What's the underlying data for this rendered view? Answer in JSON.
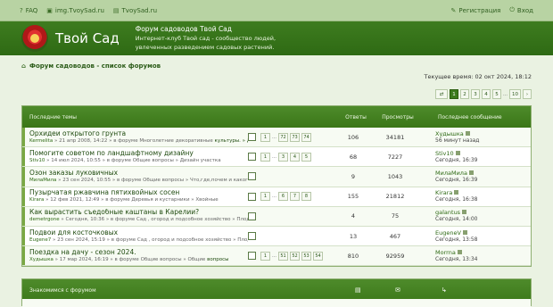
{
  "topbar": {
    "faq": "FAQ",
    "link1": "img.TvoySad.ru",
    "link2": "TvoySad.ru",
    "register": "Регистрация",
    "login": "Вход"
  },
  "header": {
    "site_name": "Твой Сад",
    "title": "Форум садоводов Твой Сад",
    "desc1": "Интернет-клуб Твой сад - сообщество людей,",
    "desc2": "увлеченных разведением садовых растений."
  },
  "breadcrumb": "Форум садоводов - список форумов",
  "time": "Текущее время: 02 окт 2024, 18:12",
  "pagination": {
    "pages": [
      "1",
      "2",
      "3",
      "4",
      "5",
      "…",
      "10"
    ],
    "active": "1"
  },
  "topics_panel": {
    "header": {
      "topics": "Последние темы",
      "replies": "Ответы",
      "views": "Просмотры",
      "last_post": "Последнее сообщение"
    },
    "rows": [
      {
        "title": "Орхидеи открытого грунта",
        "author": "Kermelita",
        "meta": " » 21 апр 2008, 14:22 » в форуме Многолетние декоративные",
        "forum2": "культуры. » Другие виды",
        "pages": [
          "72",
          "73",
          "74"
        ],
        "replies": "106",
        "views": "34181",
        "last_author": "Худышка",
        "last_date": "56 минут назад"
      },
      {
        "title": "Помогите советом по ландшафтному дизайну",
        "author": "Stiv10",
        "meta": " » 14 июл 2024, 10:55 » в форуме Общие вопросы » Дизайн участка",
        "forum2": "",
        "pages": [
          "3",
          "4",
          "5"
        ],
        "replies": "68",
        "views": "7227",
        "last_author": "Stiv10",
        "last_date": "Сегодня, 16:39"
      },
      {
        "title": "Озон заказы луковичных",
        "author": "МилаМила",
        "meta": " » 23 сен 2024, 10:55 » в форуме Общие вопросы » Что,где,почем и какого качества ?",
        "forum2": "",
        "pages": [],
        "replies": "9",
        "views": "1043",
        "last_author": "МилаМила",
        "last_date": "Сегодня, 16:39"
      },
      {
        "title": "Пузырчатая ржавчина пятихвойных сосен",
        "author": "Kirara",
        "meta": " » 12 фев 2021, 12:49 » в форуме Деревья и кустарники » Хвойные",
        "forum2": "",
        "pages": [
          "6",
          "7",
          "8"
        ],
        "replies": "155",
        "views": "21812",
        "last_author": "Kirara",
        "last_date": "Сегодня, 16:38"
      },
      {
        "title": "Как вырастить съедобные каштаны в Карелии?",
        "author": "demetrgone",
        "meta": " » Сегодня, 10:36 » в форуме Сад , огород и подсобное хозяйство » Плодовые деревья",
        "forum2": "",
        "pages": [],
        "replies": "4",
        "views": "75",
        "last_author": "galantus",
        "last_date": "Сегодня, 14:00"
      },
      {
        "title": "Подвои для косточковых",
        "author": "Eugene7",
        "meta": " » 23 сен 2024, 15:19 » в форуме Сад , огород и подсобное хозяйство » Плодовые деревья",
        "forum2": "",
        "pages": [],
        "replies": "13",
        "views": "467",
        "last_author": "EugeneV",
        "last_date": "Сегодня, 13:58"
      },
      {
        "title": "Поездка на дачу - сезон 2024.",
        "author": "Худышка",
        "meta": " » 17 мар 2024, 16:19 » в форуме Общие вопросы » Общие",
        "forum2": "вопросы",
        "pages": [
          "51",
          "52",
          "53",
          "54"
        ],
        "replies": "810",
        "views": "92959",
        "last_author": "Morrna",
        "last_date": "Сегодня, 13:34"
      }
    ]
  },
  "footer_panel": {
    "label": "Знакомимся с форумом"
  }
}
